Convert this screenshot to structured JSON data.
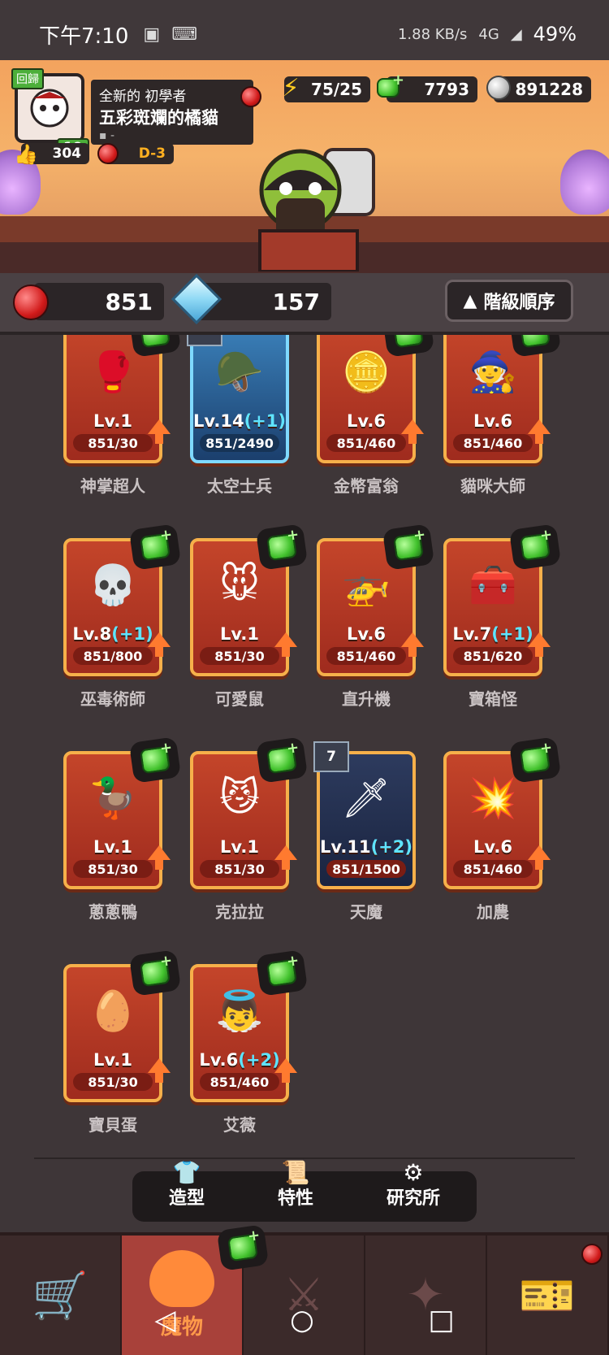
{
  "status_bar": {
    "time": "下午7:10",
    "net_speed": "1.88",
    "net_unit": "KB/s",
    "network": "4G",
    "battery": "49%"
  },
  "profile": {
    "return_badge": "回歸",
    "level": "19",
    "title": "全新的 初學者",
    "name": "五彩斑斕的橘貓",
    "extra": "-",
    "likes": "304",
    "stage": "D-3"
  },
  "resources": {
    "energy": "75/25",
    "gems": "7793",
    "coins": "891228"
  },
  "currency": {
    "red_orb": "851",
    "crystal": "157",
    "sort_label": "階級順序"
  },
  "monsters": [
    {
      "name": "神掌超人",
      "level": "Lv.1",
      "plus": "",
      "progress": "851/30",
      "style": "red",
      "badge": ""
    },
    {
      "name": "太空士兵",
      "level": "Lv.14",
      "plus": "(+1)",
      "progress": "851/2490",
      "style": "blue",
      "badge": "14"
    },
    {
      "name": "金幣富翁",
      "level": "Lv.6",
      "plus": "",
      "progress": "851/460",
      "style": "red",
      "badge": ""
    },
    {
      "name": "貓咪大師",
      "level": "Lv.6",
      "plus": "",
      "progress": "851/460",
      "style": "red",
      "badge": ""
    },
    {
      "name": "巫毒術師",
      "level": "Lv.8",
      "plus": "(+1)",
      "progress": "851/800",
      "style": "red",
      "badge": ""
    },
    {
      "name": "可愛鼠",
      "level": "Lv.1",
      "plus": "",
      "progress": "851/30",
      "style": "red",
      "badge": ""
    },
    {
      "name": "直升機",
      "level": "Lv.6",
      "plus": "",
      "progress": "851/460",
      "style": "red",
      "badge": ""
    },
    {
      "name": "寶箱怪",
      "level": "Lv.7",
      "plus": "(+1)",
      "progress": "851/620",
      "style": "red",
      "badge": ""
    },
    {
      "name": "蔥蔥鴨",
      "level": "Lv.1",
      "plus": "",
      "progress": "851/30",
      "style": "red",
      "badge": ""
    },
    {
      "name": "克拉拉",
      "level": "Lv.1",
      "plus": "",
      "progress": "851/30",
      "style": "red",
      "badge": ""
    },
    {
      "name": "天魔",
      "level": "Lv.11",
      "plus": "(+2)",
      "progress": "851/1500",
      "style": "dark",
      "badge": "7"
    },
    {
      "name": "加農",
      "level": "Lv.6",
      "plus": "",
      "progress": "851/460",
      "style": "red",
      "badge": ""
    },
    {
      "name": "寶貝蛋",
      "level": "Lv.1",
      "plus": "",
      "progress": "851/30",
      "style": "red",
      "badge": ""
    },
    {
      "name": "艾薇",
      "level": "Lv.6",
      "plus": "(+2)",
      "progress": "851/460",
      "style": "red",
      "badge": ""
    }
  ],
  "subtabs": {
    "skin": "造型",
    "traits": "特性",
    "lab": "研究所"
  },
  "bottom_nav": {
    "monsters_label": "魔物"
  },
  "colors": {
    "card_border": "#f6b04a",
    "gem_green": "#42c22d",
    "plus_cyan": "#5fe4ff",
    "upgrade_arrow": "#ff7a2f"
  }
}
